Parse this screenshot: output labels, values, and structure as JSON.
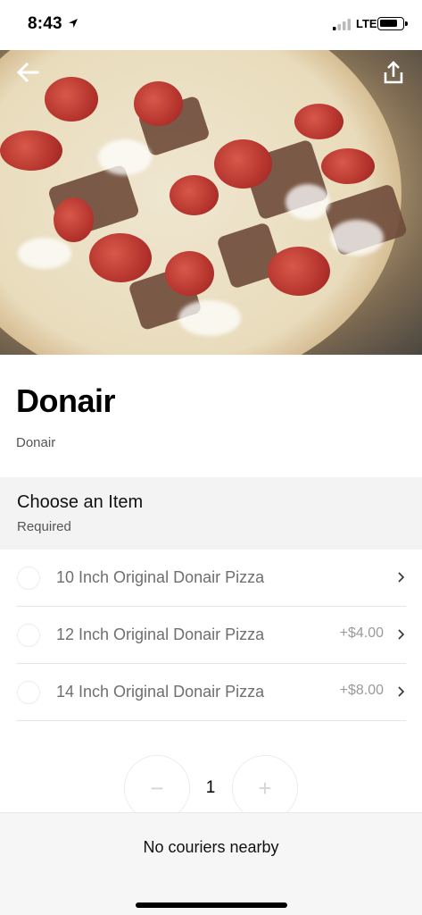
{
  "status_bar": {
    "time": "8:43",
    "network": "LTE",
    "icons": [
      "location-arrow-icon",
      "signal-icon",
      "battery-icon"
    ]
  },
  "hero": {
    "image": "pizza-photo",
    "back_icon": "arrow-left-icon",
    "share_icon": "share-icon"
  },
  "item": {
    "title": "Donair",
    "description": "Donair"
  },
  "choose_section": {
    "title": "Choose an Item",
    "requirement": "Required",
    "options": [
      {
        "label": "10 Inch Original Donair Pizza",
        "price": ""
      },
      {
        "label": "12 Inch Original Donair Pizza",
        "price": "+$4.00"
      },
      {
        "label": "14 Inch Original Donair Pizza",
        "price": "+$8.00"
      }
    ]
  },
  "quantity": {
    "minus": "−",
    "value": "1",
    "plus": "+"
  },
  "footer": {
    "message": "No couriers nearby"
  },
  "colors": {
    "background": "#ffffff",
    "section_bg": "#f3f3f3",
    "footer_bg": "#f6f6f6",
    "muted_text": "#6f6f6f"
  }
}
